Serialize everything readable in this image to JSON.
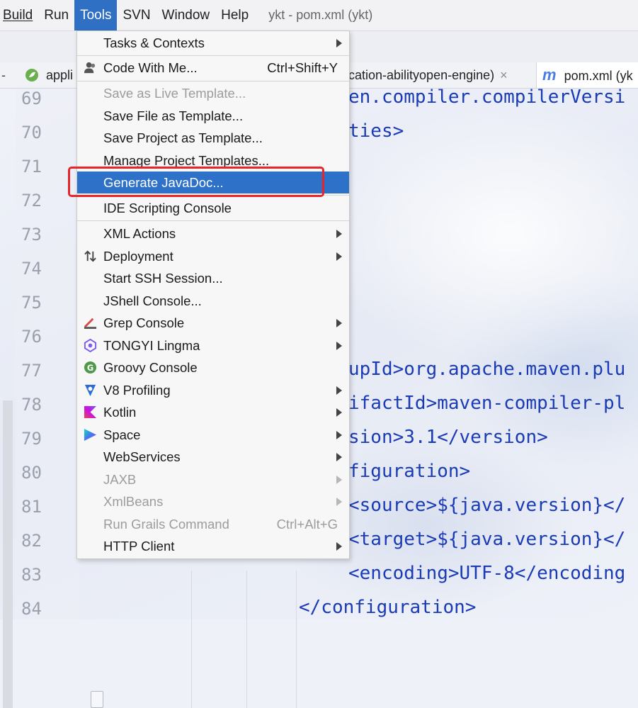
{
  "menubar": {
    "items": [
      "Build",
      "Run",
      "Tools",
      "SVN",
      "Window",
      "Help"
    ],
    "title": "ykt - pom.xml (ykt)"
  },
  "tabs": {
    "minus": "-",
    "left_tab": "appli",
    "middle_tab": "cation-abilityopen-engine)",
    "middle_close": "×",
    "pom_tab": "pom.xml (yk",
    "pom_icon": "m"
  },
  "editor": {
    "line_numbers": [
      "69",
      "70",
      "71",
      "72",
      "73",
      "74",
      "75",
      "76",
      "77",
      "78",
      "79",
      "80",
      "81",
      "82",
      "83",
      "84"
    ],
    "lines": {
      "l69": "en.compiler.compilerVersi",
      "l70": "ties>",
      "l77": "upId>org.apache.maven.plu",
      "l78": "ifactId>maven-compiler-pl",
      "l79": "sion>3.1</version>",
      "l80": "figuration>",
      "l81": "<source>${java.version}</",
      "l82": "<target>${java.version}</",
      "l83": "<encoding>UTF-8</encoding",
      "l84": "</configuration>"
    }
  },
  "tools_menu": {
    "items": [
      {
        "label": "Tasks & Contexts",
        "submenu": true
      },
      {
        "label": "Code With Me...",
        "shortcut": "Ctrl+Shift+Y",
        "icon": "users-icon"
      },
      {
        "label": "Save as Live Template...",
        "disabled": true
      },
      {
        "label": "Save File as Template..."
      },
      {
        "label": "Save Project as Template..."
      },
      {
        "label": "Manage Project Templates..."
      },
      {
        "label": "Generate JavaDoc...",
        "selected": true
      },
      {
        "label": "IDE Scripting Console"
      },
      {
        "label": "XML Actions",
        "submenu": true
      },
      {
        "label": "Deployment",
        "submenu": true,
        "icon": "deployment-arrows-icon"
      },
      {
        "label": "Start SSH Session..."
      },
      {
        "label": "JShell Console..."
      },
      {
        "label": "Grep Console",
        "submenu": true,
        "icon": "grep-console-icon"
      },
      {
        "label": "TONGYI Lingma",
        "submenu": true,
        "icon": "lingma-icon"
      },
      {
        "label": "Groovy Console",
        "icon": "groovy-icon"
      },
      {
        "label": "V8 Profiling",
        "submenu": true,
        "icon": "v8-icon"
      },
      {
        "label": "Kotlin",
        "submenu": true,
        "icon": "kotlin-icon"
      },
      {
        "label": "Space",
        "submenu": true,
        "icon": "space-icon"
      },
      {
        "label": "WebServices",
        "submenu": true
      },
      {
        "label": "JAXB",
        "submenu": true,
        "disabled": true
      },
      {
        "label": "XmlBeans",
        "submenu": true,
        "disabled": true
      },
      {
        "label": "Run Grails Command",
        "shortcut": "Ctrl+Alt+G",
        "disabled": true
      },
      {
        "label": "HTTP Client",
        "submenu": true
      }
    ]
  },
  "colors": {
    "selection": "#2e71c9",
    "highlight_box": "#e8262a",
    "xml_tag": "#1a3bb5"
  }
}
